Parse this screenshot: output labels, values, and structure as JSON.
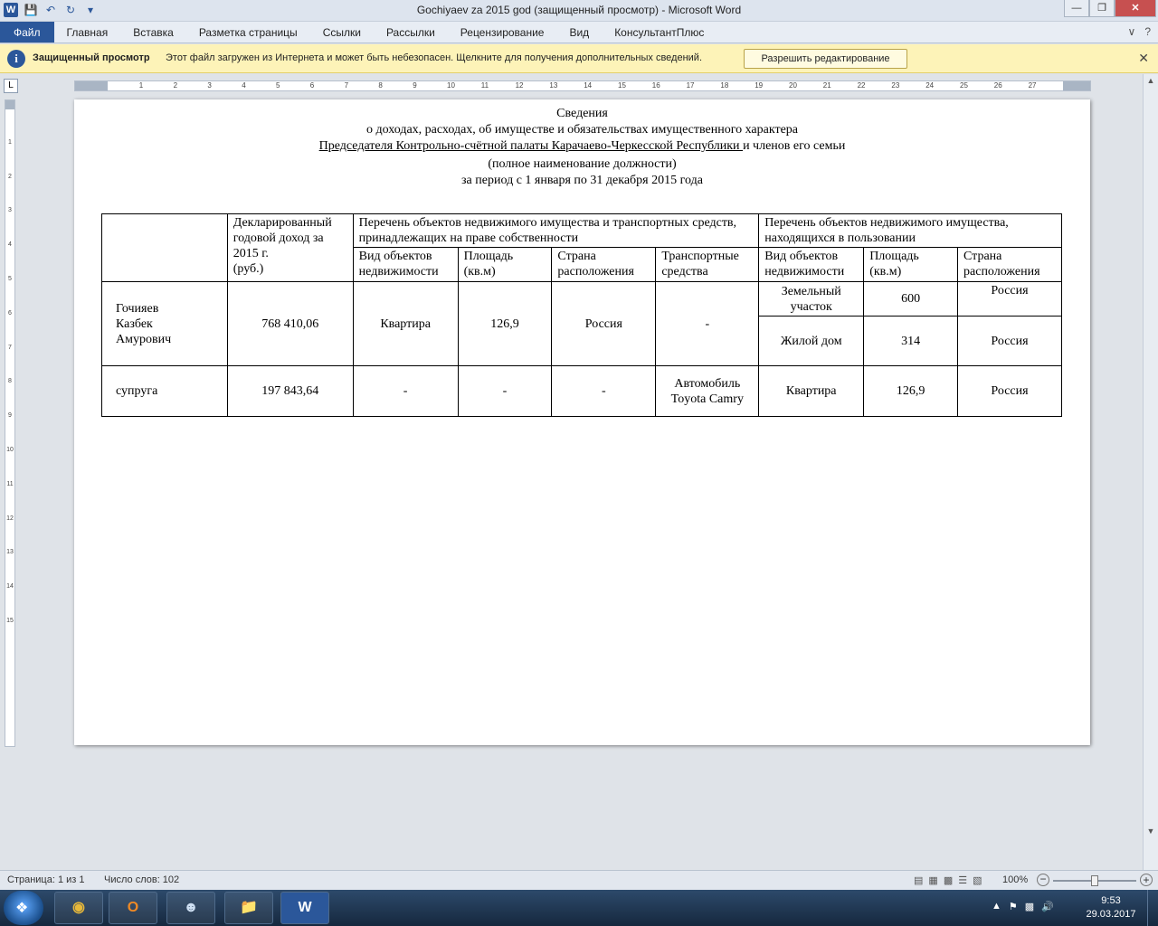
{
  "window": {
    "title": "Gochiyaev za 2015 god (защищенный просмотр)  -  Microsoft Word"
  },
  "ribbon": {
    "tabs": [
      "Файл",
      "Главная",
      "Вставка",
      "Разметка страницы",
      "Ссылки",
      "Рассылки",
      "Рецензирование",
      "Вид",
      "КонсультантПлюс"
    ]
  },
  "protected_view": {
    "title": "Защищенный просмотр",
    "message": "Этот файл загружен из Интернета и может быть небезопасен. Щелкните для получения дополнительных сведений.",
    "button": "Разрешить редактирование"
  },
  "document": {
    "line1": "Сведения",
    "line2": "о доходах, расходах, об имуществе и обязательствах имущественного характера",
    "line3_underlined": "Председателя  Контрольно-счётной палаты Карачаево-Черкесской Республики ",
    "line3_rest": " и членов его семьи",
    "line4": "(полное наименование должности)",
    "line5": "за период с 1 января по 31 декабря 2015 года",
    "table": {
      "h_income": "Декларированный годовой доход за 2015 г.",
      "h_income_unit": "(руб.)",
      "h_owned": "Перечень объектов недвижимого имущества и транспортных средств, принадлежащих на праве собственности",
      "h_used": "Перечень объектов недвижимого имущества, находящихся в пользовании",
      "h_owned_type": "Вид объектов недвижимости",
      "h_owned_area": "Площадь (кв.м)",
      "h_owned_country": "Страна расположения",
      "h_owned_vehicles": "Транспортные средства",
      "h_used_type": "Вид объектов недвижимости",
      "h_used_area": "Площадь (кв.м)",
      "h_used_country": "Страна расположения",
      "r1_name_1": "Гочияев",
      "r1_name_2": "Казбек",
      "r1_name_3": "Амурович",
      "r1_income": "768 410,06",
      "r1_owned_type": "Квартира",
      "r1_owned_area": "126,9",
      "r1_owned_country": "Россия",
      "r1_vehicles": "-",
      "r1_used1_type": "Земельный участок",
      "r1_used1_area": "600",
      "r1_used1_country": "Россия",
      "r1_used2_type": "Жилой дом",
      "r1_used2_area": "314",
      "r1_used2_country": "Россия",
      "r2_name": "супруга",
      "r2_income": "197 843,64",
      "r2_owned_type": "-",
      "r2_owned_area": "-",
      "r2_owned_country": "-",
      "r2_vehicle_1": "Автомобиль",
      "r2_vehicle_2": "Toyota Camry",
      "r2_used_type": "Квартира",
      "r2_used_area": "126,9",
      "r2_used_country": "Россия"
    }
  },
  "statusbar": {
    "page": "Страница: 1 из 1",
    "words": "Число слов: 102",
    "zoom": "100%"
  },
  "taskbar": {
    "time": "9:53",
    "date": "29.03.2017"
  },
  "colors": {
    "accent": "#2b579a",
    "protected_bar": "#fdf3b8"
  }
}
